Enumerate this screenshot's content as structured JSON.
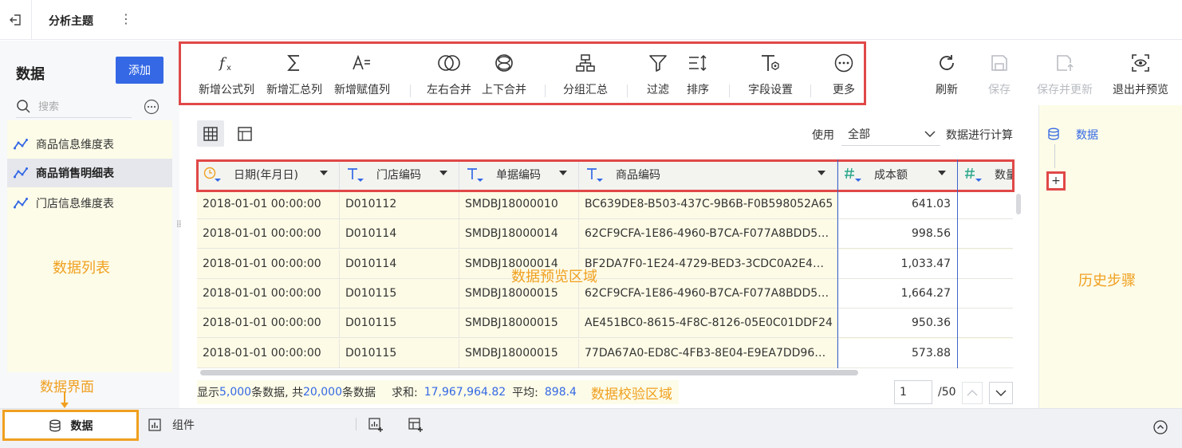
{
  "topbar": {
    "title": "分析主题",
    "more": "⋮"
  },
  "left_panel": {
    "title": "数据",
    "add_label": "添加",
    "search_placeholder": "搜索",
    "tables": [
      {
        "label": "商品信息维度表",
        "active": false
      },
      {
        "label": "商品销售明细表",
        "active": true
      },
      {
        "label": "门店信息维度表",
        "active": false
      }
    ],
    "annotation": "数据列表"
  },
  "toolbar": {
    "items": [
      {
        "label": "新增公式列",
        "icon": "formula-icon"
      },
      {
        "label": "新增汇总列",
        "icon": "sigma-icon"
      },
      {
        "label": "新增赋值列",
        "icon": "assign-icon"
      },
      {
        "label": "左右合并",
        "icon": "merge-lr-icon"
      },
      {
        "label": "上下合并",
        "icon": "merge-ud-icon"
      },
      {
        "label": "分组汇总",
        "icon": "group-icon"
      },
      {
        "label": "过滤",
        "icon": "filter-icon"
      },
      {
        "label": "排序",
        "icon": "sort-icon"
      },
      {
        "label": "字段设置",
        "icon": "field-settings-icon"
      },
      {
        "label": "更多",
        "icon": "more-icon"
      }
    ],
    "right_items": [
      {
        "label": "刷新",
        "icon": "refresh-icon",
        "disabled": false
      },
      {
        "label": "保存",
        "icon": "save-icon",
        "disabled": true
      },
      {
        "label": "保存并更新",
        "icon": "save-update-icon",
        "disabled": true
      },
      {
        "label": "退出并预览",
        "icon": "exit-preview-icon",
        "disabled": false
      }
    ]
  },
  "grid_controls": {
    "use_label": "使用",
    "use_value": "全部",
    "calc_label": "数据进行计算"
  },
  "table": {
    "columns": [
      {
        "label": "日期(年月日)",
        "type": "date"
      },
      {
        "label": "门店编码",
        "type": "text"
      },
      {
        "label": "单据编码",
        "type": "text"
      },
      {
        "label": "商品编码",
        "type": "text"
      },
      {
        "label": "成本额",
        "type": "number"
      },
      {
        "label": "数量",
        "type": "number"
      }
    ],
    "rows": [
      [
        "2018-01-01 00:00:00",
        "D010112",
        "SMDBJ18000010",
        "BC639DE8-B503-437C-9B6B-F0B598052A65",
        "641.03"
      ],
      [
        "2018-01-01 00:00:00",
        "D010114",
        "SMDBJ18000014",
        "62CF9CFA-1E86-4960-B7CA-F077A8BDD5…",
        "998.56"
      ],
      [
        "2018-01-01 00:00:00",
        "D010114",
        "SMDBJ18000014",
        "BF2DA7F0-1E24-4729-BED3-3CDC0A2E4…",
        "1,033.47"
      ],
      [
        "2018-01-01 00:00:00",
        "D010115",
        "SMDBJ18000015",
        "62CF9CFA-1E86-4960-B7CA-F077A8BDD5…",
        "1,664.27"
      ],
      [
        "2018-01-01 00:00:00",
        "D010115",
        "SMDBJ18000015",
        "AE451BC0-8615-4F8C-8126-05E0C01DDF24",
        "950.36"
      ],
      [
        "2018-01-01 00:00:00",
        "D010115",
        "SMDBJ18000015",
        "77DA67A0-ED8C-4FB3-8E04-E9EA7DD96…",
        "573.88"
      ]
    ],
    "annotation": "数据预览区域"
  },
  "stats": {
    "show_prefix": "显示",
    "shown": "5,000",
    "show_mid": "条数据, 共",
    "total": "20,000",
    "show_suffix": "条数据",
    "sum_label": "求和:",
    "sum_value": "17,967,964.82",
    "avg_label": "平均:",
    "avg_value": "898.4",
    "annotation": "数据校验区域"
  },
  "pagination": {
    "page": "1",
    "total": "/50"
  },
  "right_panel": {
    "data_label": "数据",
    "plus": "+",
    "annotation": "历史步骤"
  },
  "bottom_bar": {
    "data_tab": "数据",
    "component_tab": "组件",
    "annotation": "数据界面"
  },
  "colors": {
    "accent": "#3468e5",
    "highlight_box": "#e04848",
    "annotation": "#f0a020"
  }
}
